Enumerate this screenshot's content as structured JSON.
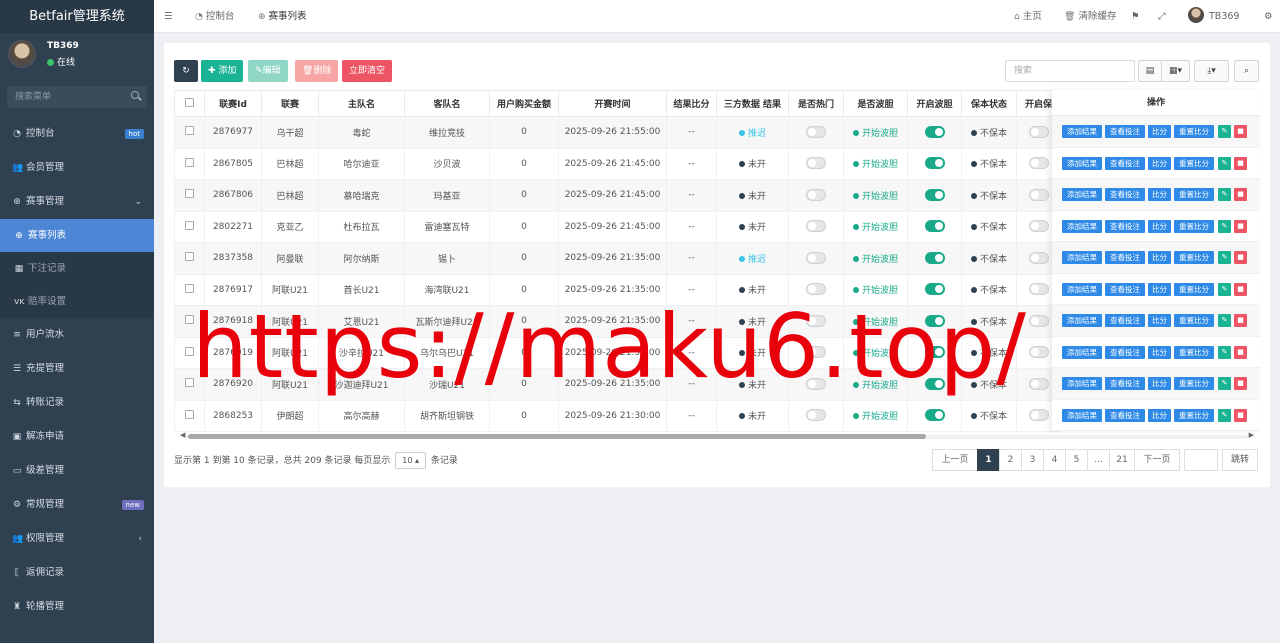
{
  "app": {
    "brand": "Betfair管理系统"
  },
  "user": {
    "name": "TB369",
    "status": "在线"
  },
  "sidebar": {
    "search_placeholder": "搜索菜单",
    "items": [
      {
        "label": "控制台",
        "icon": "dashboard-icon",
        "badge": "hot"
      },
      {
        "label": "会员管理",
        "icon": "users-icon"
      },
      {
        "label": "赛事管理",
        "icon": "globe-icon",
        "expanded": true
      },
      {
        "label": "赛事列表",
        "icon": "globe-icon",
        "active": true
      },
      {
        "label": "下注记录",
        "icon": "calendar-icon"
      },
      {
        "label": "赔率设置",
        "icon": "vk-icon"
      },
      {
        "label": "用户流水",
        "icon": "list-icon"
      },
      {
        "label": "充提管理",
        "icon": "list-alt-icon"
      },
      {
        "label": "转账记录",
        "icon": "transfer-icon"
      },
      {
        "label": "解冻申请",
        "icon": "square-icon"
      },
      {
        "label": "级差管理",
        "icon": "window-icon"
      },
      {
        "label": "常规管理",
        "icon": "cogs-icon",
        "badge": "new"
      },
      {
        "label": "权限管理",
        "icon": "group-icon"
      },
      {
        "label": "返佣记录",
        "icon": "bracket-icon"
      },
      {
        "label": "轮播管理",
        "icon": "trophy-icon"
      }
    ]
  },
  "topbar": {
    "tabs": [
      {
        "label": "控制台",
        "icon": "dashboard-icon"
      },
      {
        "label": "赛事列表",
        "icon": "globe-icon"
      }
    ],
    "right": {
      "home": "主页",
      "clear_cache": "清除缓存",
      "username": "TB369"
    }
  },
  "toolbar": {
    "add": "添加",
    "edit": "编辑",
    "delete": "删除",
    "clear_now": "立即清空",
    "search_placeholder": "搜索"
  },
  "table": {
    "headers": [
      "联赛Id",
      "联赛",
      "主队名",
      "客队名",
      "用户购买金额",
      "开赛时间",
      "结果比分",
      "三方数据 结果",
      "是否热门",
      "是否波胆",
      "开启波胆",
      "保本状态",
      "开启保"
    ],
    "ops_header": "操作",
    "rows": [
      {
        "id": "2876977",
        "league": "乌干超",
        "home": "毒蛇",
        "away": "维拉竞技",
        "amount": "0",
        "time": "2025-09-26 21:55:00",
        "score": "--",
        "third": "推迟",
        "third_color": "#39c5e8",
        "hot": false,
        "bodan": "开始波胆",
        "open_bodan": true,
        "baoben": "不保本"
      },
      {
        "id": "2867805",
        "league": "巴林超",
        "home": "哈尔迪亚",
        "away": "沙贝波",
        "amount": "0",
        "time": "2025-09-26 21:45:00",
        "score": "--",
        "third": "未开",
        "third_color": "#2f4050",
        "hot": false,
        "bodan": "开始波胆",
        "open_bodan": true,
        "baoben": "不保本"
      },
      {
        "id": "2867806",
        "league": "巴林超",
        "home": "慕哈瑞克",
        "away": "玛基亚",
        "amount": "0",
        "time": "2025-09-26 21:45:00",
        "score": "--",
        "third": "未开",
        "third_color": "#2f4050",
        "hot": false,
        "bodan": "开始波胆",
        "open_bodan": true,
        "baoben": "不保本"
      },
      {
        "id": "2802271",
        "league": "克亚乙",
        "home": "杜布拉瓦",
        "away": "雷迪塞瓦特",
        "amount": "0",
        "time": "2025-09-26 21:45:00",
        "score": "--",
        "third": "未开",
        "third_color": "#2f4050",
        "hot": false,
        "bodan": "开始波胆",
        "open_bodan": true,
        "baoben": "不保本"
      },
      {
        "id": "2837358",
        "league": "阿曼联",
        "home": "阿尔纳斯",
        "away": "锡卜",
        "amount": "0",
        "time": "2025-09-26 21:35:00",
        "score": "--",
        "third": "推迟",
        "third_color": "#39c5e8",
        "hot": false,
        "bodan": "开始波胆",
        "open_bodan": true,
        "baoben": "不保本"
      },
      {
        "id": "2876917",
        "league": "阿联U21",
        "home": "酋长U21",
        "away": "海湾联U21",
        "amount": "0",
        "time": "2025-09-26 21:35:00",
        "score": "--",
        "third": "未开",
        "third_color": "#2f4050",
        "hot": false,
        "bodan": "开始波胆",
        "open_bodan": true,
        "baoben": "不保本"
      },
      {
        "id": "2876918",
        "league": "阿联U21",
        "home": "艾恩U21",
        "away": "瓦斯尔迪拜U21",
        "amount": "0",
        "time": "2025-09-26 21:35:00",
        "score": "--",
        "third": "未开",
        "third_color": "#2f4050",
        "hot": false,
        "bodan": "开始波胆",
        "open_bodan": true,
        "baoben": "不保本"
      },
      {
        "id": "2876919",
        "league": "阿联U21",
        "home": "沙辛拉U21",
        "away": "乌尔乌巴U21",
        "amount": "0",
        "time": "2025-09-26 21:35:00",
        "score": "--",
        "third": "未开",
        "third_color": "#2f4050",
        "hot": false,
        "bodan": "开始波胆",
        "open_bodan": true,
        "baoben": "不保本"
      },
      {
        "id": "2876920",
        "league": "阿联U21",
        "home": "沙迦迪拜U21",
        "away": "沙瑞U21",
        "amount": "0",
        "time": "2025-09-26 21:35:00",
        "score": "--",
        "third": "未开",
        "third_color": "#2f4050",
        "hot": false,
        "bodan": "开始波胆",
        "open_bodan": true,
        "baoben": "不保本"
      },
      {
        "id": "2868253",
        "league": "伊朗超",
        "home": "高尔高赫",
        "away": "胡齐斯坦钢铁",
        "amount": "0",
        "time": "2025-09-26 21:30:00",
        "score": "--",
        "third": "未开",
        "third_color": "#2f4050",
        "hot": false,
        "bodan": "开始波胆",
        "open_bodan": true,
        "baoben": "不保本"
      }
    ],
    "row_actions": {
      "add_result": "添加结果",
      "view_bets": "查看投注",
      "score": "比分",
      "reset_score": "重置比分"
    }
  },
  "pagination": {
    "info_prefix": "显示第 1 到第 10 条记录，总共 209 条记录 每页显示",
    "page_size": "10",
    "info_suffix": "条记录",
    "prev": "上一页",
    "next": "下一页",
    "pages": [
      "1",
      "2",
      "3",
      "4",
      "5",
      "...",
      "21"
    ],
    "current": "1",
    "jump": "跳转"
  },
  "watermark": "https://maku6.top/",
  "colors": {
    "sidebar_bg": "#2f4050",
    "active_blue": "#3b7fd0",
    "btn_add": "#1ab394",
    "btn_edit": "#8fd6c5",
    "btn_delete": "#f6a4a4",
    "btn_clear": "#ed5565",
    "bodan_green": "#1aaa8a",
    "op_blue": "#2e8ae6",
    "watermark_red": "#e8000a"
  }
}
